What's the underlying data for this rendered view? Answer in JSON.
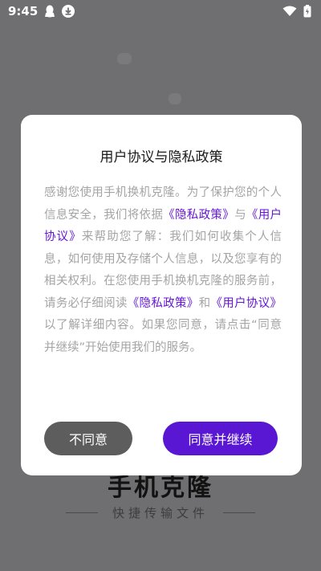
{
  "status_bar": {
    "time": "9:45",
    "icons": [
      "qq-penguin-icon",
      "download-icon",
      "wifi-icon",
      "battery-icon"
    ]
  },
  "background": {
    "title": "手机克隆",
    "subtitle": "快捷传输文件"
  },
  "dialog": {
    "title": "用户协议与隐私政策",
    "body_parts": {
      "p1": "感谢您使用手机换机克隆。为了保护您的个人信息安全，我们将依据",
      "link1": "《隐私政策》",
      "p2": "与",
      "link2": "《用户协议》",
      "p3": "来帮助您了解：我们如何收集个人信息，如何使用及存储个人信息，以及您享有的相关权利。在您使用手机换机克隆的服务前，请务必仔细阅读",
      "link3": "《隐私政策》",
      "p4": "和",
      "link4": "《用户协议》",
      "p5": "以了解详细内容。如果您同意，请点击“同意并继续”开始使用我们的服务。"
    },
    "decline_label": "不同意",
    "agree_label": "同意并继续"
  },
  "colors": {
    "accent": "#5a17d3",
    "link": "#6517d6",
    "decline_button": "#5d5d5d",
    "body_text": "#a4a4a4",
    "overlay": "#6f6f71"
  }
}
